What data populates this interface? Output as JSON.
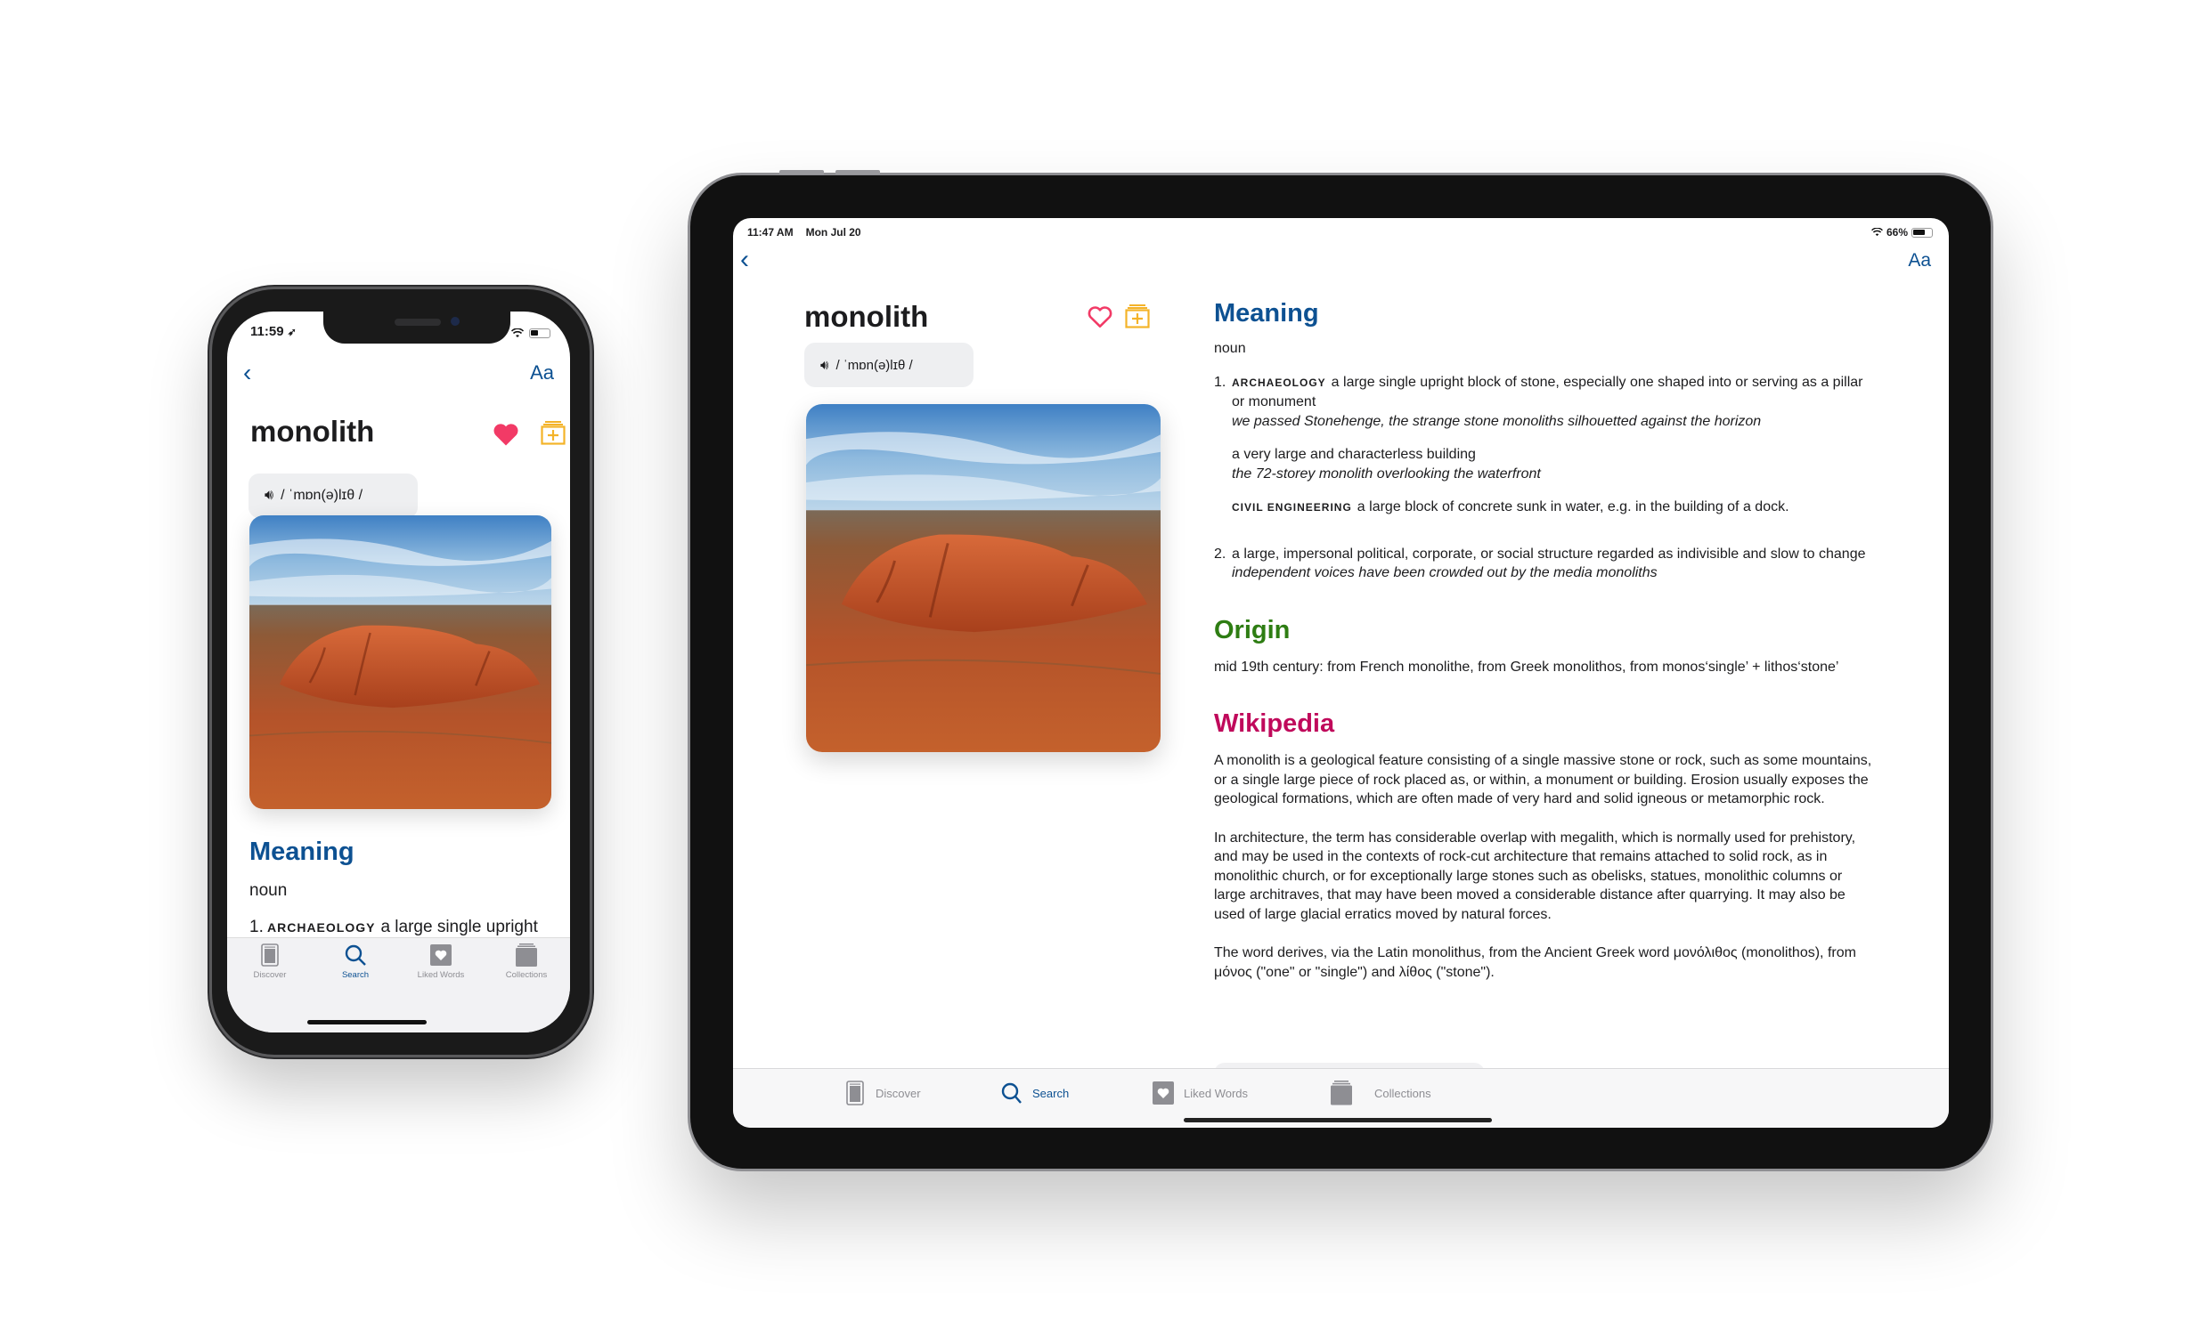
{
  "colors": {
    "accent_blue": "#0d5192",
    "heart_pink": "#f23a66",
    "collection_yellow": "#f4b329",
    "origin_green": "#2e7d13",
    "wikipedia_magenta": "#c0095b",
    "tab_inactive": "#8e8e93"
  },
  "phone": {
    "status": {
      "time": "11:59",
      "location_icon": "location-arrow-icon",
      "icons": [
        "airplane-icon",
        "wifi-icon",
        "battery-icon"
      ]
    },
    "nav": {
      "back_icon": "chevron-left-icon",
      "font_button": "Aa"
    },
    "word": "monolith",
    "liked": true,
    "pronunciation": "/ ˈmɒn(ə)lɪθ /",
    "meaning": {
      "heading": "Meaning",
      "part_of_speech": "noun",
      "definition_number": "1.",
      "definition_tag": "ARCHAEOLOGY",
      "definition_text": "a large single upright block of stone, especially one shaped into or serving as a pillar or monument"
    },
    "tabs": [
      {
        "label": "Discover",
        "icon": "discover-icon",
        "active": false
      },
      {
        "label": "Search",
        "icon": "search-icon",
        "active": true
      },
      {
        "label": "Liked Words",
        "icon": "liked-words-icon",
        "active": false
      },
      {
        "label": "Collections",
        "icon": "collections-icon",
        "active": false
      }
    ]
  },
  "ipad": {
    "status": {
      "time": "11:47 AM",
      "date": "Mon Jul 20",
      "battery": "66%"
    },
    "nav": {
      "back_icon": "chevron-left-icon",
      "font_button": "Aa"
    },
    "word": "monolith",
    "liked": false,
    "pronunciation": "/ ˈmɒn(ə)lɪθ /",
    "meaning": {
      "heading": "Meaning",
      "part_of_speech": "noun",
      "definitions": [
        {
          "number": "1.",
          "tag": "ARCHAEOLOGY",
          "text": "a large single upright block of stone, especially one shaped into or serving as a pillar or monument",
          "example": "we passed Stonehenge, the strange stone monoliths silhouetted against the horizon",
          "subsenses": [
            {
              "tag": "",
              "text": "a very large and characterless building",
              "example": "the 72-storey monolith overlooking the waterfront"
            },
            {
              "tag": "CIVIL ENGINEERING",
              "text": "a large block of concrete sunk in water, e.g. in the building of a dock.",
              "example": ""
            }
          ]
        },
        {
          "number": "2.",
          "tag": "",
          "text": "a large, impersonal political, corporate, or social structure regarded as indivisible and slow to change",
          "example": "independent voices have been crowded out by the media monoliths"
        }
      ]
    },
    "origin": {
      "heading": "Origin",
      "text": "mid 19th century: from French monolithe, from Greek monolithos, from monos‘single’ + lithos‘stone’"
    },
    "wikipedia": {
      "heading": "Wikipedia",
      "paragraphs": [
        "A monolith is a geological feature consisting of a single massive stone or rock, such as some mountains, or a single large piece of rock placed as, or within, a monument or building. Erosion usually exposes the geological formations, which are often made of very hard and solid igneous or metamorphic rock.",
        "In architecture, the term has considerable overlap with megalith, which is normally used for prehistory, and may be used in the contexts of rock-cut architecture that remains attached to solid rock, as in monolithic church, or for exceptionally large stones such as obelisks, statues, monolithic columns or large architraves, that may have been moved a considerable distance after quarrying. It may also be used of large glacial erratics moved by natural forces.",
        "The word derives, via the Latin monolithus, from the Ancient Greek word μονόλιθος (monolithos), from μόνος (\"one\" or \"single\") and λίθος (\"stone\")."
      ]
    },
    "tabs": [
      {
        "label": "Discover",
        "icon": "discover-icon",
        "active": false
      },
      {
        "label": "Search",
        "icon": "search-icon",
        "active": true
      },
      {
        "label": "Liked Words",
        "icon": "liked-words-icon",
        "active": false
      },
      {
        "label": "Collections",
        "icon": "collections-icon",
        "active": false
      }
    ]
  }
}
